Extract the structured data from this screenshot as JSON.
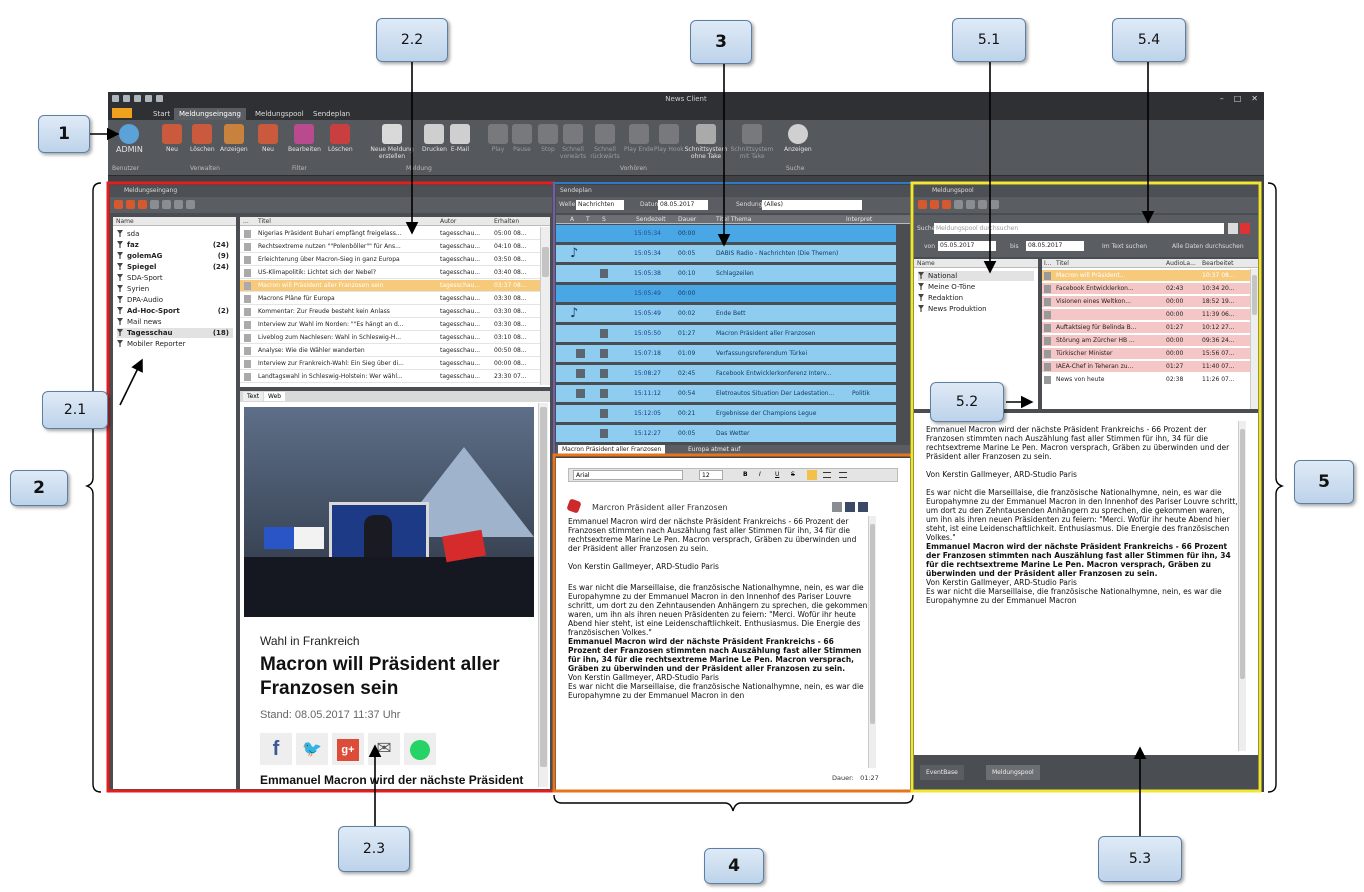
{
  "window": {
    "title": "News Client"
  },
  "tabs": [
    "Start",
    "Meldungseingang",
    "Meldungspool",
    "Sendeplan"
  ],
  "app_button": "",
  "ribbon": {
    "user": "ADMIN",
    "buttons": [
      "Neu",
      "Löschen",
      "Anzeigen",
      "Neu",
      "Bearbeiten",
      "Löschen",
      "Neue Meldung erstellen",
      "Drucken",
      "E-Mail",
      "Play",
      "Pause",
      "Stop",
      "Schnell vorwärts",
      "Schnell rückwärts",
      "Play Ende",
      "Play Hook",
      "Schnittsystem ohne Take",
      "Schnittsystem mit Take",
      "Anzeigen"
    ],
    "groups": [
      "Benutzer",
      "Verwalten",
      "Filter",
      "Meldung",
      "Vorhören",
      "Suche"
    ]
  },
  "meldungseingang": {
    "title": "Meldungseingang",
    "filter_header": "Name",
    "filters": [
      {
        "name": "sda",
        "count": "",
        "bold": false
      },
      {
        "name": "faz",
        "count": "(24)",
        "bold": true
      },
      {
        "name": "golemAG",
        "count": "(9)",
        "bold": true
      },
      {
        "name": "Spiegel",
        "count": "(24)",
        "bold": true
      },
      {
        "name": "SDA-Sport",
        "count": "",
        "bold": false
      },
      {
        "name": "Syrien",
        "count": "",
        "bold": false
      },
      {
        "name": "DPA-Audio",
        "count": "",
        "bold": false
      },
      {
        "name": "Ad-Hoc-Sport",
        "count": "(2)",
        "bold": true
      },
      {
        "name": "Mail news",
        "count": "",
        "bold": false
      },
      {
        "name": "Tagesschau",
        "count": "(18)",
        "bold": true
      },
      {
        "name": "Mobiler Reporter",
        "count": "",
        "bold": false
      }
    ],
    "columns": [
      "...",
      "Titel",
      "Autor",
      "Erhalten"
    ],
    "rows": [
      [
        "Nigerias Präsident Buhari empfängt freigelass...",
        "tagesschau...",
        "05:00 08..."
      ],
      [
        "Rechtsextreme nutzen \"\"Polenböller\"\" für Ans...",
        "tagesschau...",
        "04:10 08..."
      ],
      [
        "Erleichterung über Macron-Sieg in ganz Europa",
        "tagesschau...",
        "03:50 08..."
      ],
      [
        "US-Klimapolitik: Lichtet sich der Nebel?",
        "tagesschau...",
        "03:40 08..."
      ],
      [
        "Macron will Präsident aller Franzosen sein",
        "tagesschau...",
        "03:37 08..."
      ],
      [
        "Macrons Pläne für Europa",
        "tagesschau...",
        "03:30 08..."
      ],
      [
        "Kommentar: Zur Freude besteht kein Anlass",
        "tagesschau...",
        "03:30 08..."
      ],
      [
        "Interview zur Wahl im Norden: \"\"Es hängt an d...",
        "tagesschau...",
        "03:30 08..."
      ],
      [
        "Liveblog zum Nachlesen: Wahl in Schleswig-H...",
        "tagesschau...",
        "03:10 08..."
      ],
      [
        "Analyse: Wie die Wähler wanderten",
        "tagesschau...",
        "00:50 08..."
      ],
      [
        "Interview zur Frankreich-Wahl: Ein Sieg über di...",
        "tagesschau...",
        "00:00 08..."
      ],
      [
        "Landtagswahl in Schleswig-Holstein: Wer wähl...",
        "tagesschau...",
        "23:30 07..."
      ]
    ],
    "view_tabs": [
      "Text",
      "Web"
    ],
    "web": {
      "kicker": "Wahl in Frankreich",
      "headline": "Macron will Präsident aller Franzosen sein",
      "stand": "Stand: 08.05.2017 11:37 Uhr",
      "lead": "Emmanuel Macron wird der nächste Präsident Frankreichs - 66,1 Prozent der"
    }
  },
  "sendeplan": {
    "title": "Sendeplan",
    "welle_label": "Welle",
    "welle_value": "Nachrichten",
    "datum_label": "Datum",
    "datum_value": "08.05.2017",
    "sendung_label": "Sendung",
    "sendung_value": "(Alles)",
    "columns": [
      "A",
      "T",
      "S",
      "Sendezeit",
      "Dauer",
      "Titel Thema",
      "Interpret"
    ],
    "rows": [
      {
        "time": "15:05:34",
        "dur": "00:00",
        "title": "",
        "interpret": ""
      },
      {
        "time": "15:05:34",
        "dur": "00:05",
        "title": "DABIS Radio - Nachrichten (Die Themen)",
        "interpret": ""
      },
      {
        "time": "15:05:38",
        "dur": "00:10",
        "title": "Schlagzeilen",
        "interpret": ""
      },
      {
        "time": "15:05:49",
        "dur": "00:00",
        "title": "",
        "interpret": ""
      },
      {
        "time": "15:05:49",
        "dur": "00:02",
        "title": "Ende Bett",
        "interpret": ""
      },
      {
        "time": "15:05:50",
        "dur": "01:27",
        "title": "Macron Präsident aller Franzosen",
        "interpret": ""
      },
      {
        "time": "15:07:18",
        "dur": "01:09",
        "title": "Verfassungsreferendum Türkei",
        "interpret": ""
      },
      {
        "time": "15:08:27",
        "dur": "02:45",
        "title": "Facebook Entwicklerkonferenz  Interv...",
        "interpret": ""
      },
      {
        "time": "15:11:12",
        "dur": "00:54",
        "title": "Eletroautos Situation Der Ladestation...",
        "interpret": "Politik"
      },
      {
        "time": "15:12:05",
        "dur": "00:21",
        "title": "Ergebnisse der Champions Legue",
        "interpret": ""
      },
      {
        "time": "15:12:27",
        "dur": "00:05",
        "title": "Das Wetter",
        "interpret": ""
      }
    ],
    "doc_tabs": [
      "Macron Präsident aller Franzosen",
      "Europa atmet auf"
    ]
  },
  "editor": {
    "font": "Arial",
    "size": "12",
    "format_buttons": [
      "B",
      "I",
      "U",
      "S"
    ],
    "title": "Marcron Präsident aller Franzosen",
    "p1": "Emmanuel Macron wird der nächste Präsident Frankreichs - 66 Prozent der Franzosen stimmten nach Auszählung fast aller Stimmen für ihn, 34 für die rechtsextreme Marine Le Pen. Macron versprach, Gräben zu überwinden und der Präsident aller Franzosen zu sein.",
    "p2": "Von Kerstin Gallmeyer, ARD-Studio Paris",
    "p3": "Es war nicht die Marseillaise, die französische Nationalhymne, nein, es war die Europahymne zu der Emmanuel Macron in den Innenhof des Pariser Louvre schritt, um dort zu den Zehntausenden Anhängern zu sprechen, die gekommen waren, um ihn als ihren neuen Präsidenten zu feiern: \"Merci. Wofür ihr heute Abend hier steht, ist eine Leidenschaftlichkeit. Enthusiasmus. Die Energie des französischen Volkes.\"",
    "p4": "Emmanuel Macron wird der nächste Präsident Frankreichs - 66 Prozent der Franzosen stimmten nach Auszählung fast aller Stimmen für ihn, 34 für die rechtsextreme Marine Le Pen. Macron versprach, Gräben zu überwinden und der Präsident aller Franzosen zu sein.",
    "p5": "Von Kerstin Gallmeyer, ARD-Studio Paris",
    "p6": "Es war nicht die Marseillaise, die französische Nationalhymne, nein, es war die Europahymne zu der Emmanuel Macron in den",
    "duration_label": "Dauer:",
    "duration_value": "01:27"
  },
  "meldungspool": {
    "title": "Meldungspool",
    "search_label": "Suche",
    "search_placeholder": "Meldungspool durchsuchen",
    "von_label": "von",
    "von_value": "05.05.2017",
    "bis_label": "bis",
    "bis_value": "08.05.2017",
    "opt1": "Im Text suchen",
    "opt2": "Alle Daten durchsuchen",
    "tree_header": "Name",
    "tree": [
      "National",
      "Meine O-Töne",
      "Redaktion",
      "News Produktion"
    ],
    "columns": [
      "I...",
      "Titel",
      "AudioLa...",
      "Bearbeitet"
    ],
    "rows": [
      [
        "Macron will Präsident...",
        "",
        "10:37 08..."
      ],
      [
        "Facebook Entwicklerkon...",
        "02:43",
        "10:34 20..."
      ],
      [
        "Visionen eines Weltkon...",
        "00:00",
        "18:52 19..."
      ],
      [
        "",
        "00:00",
        "11:39 06..."
      ],
      [
        "Auftaktsieg für Belinda B...",
        "01:27",
        "10:12 27..."
      ],
      [
        "Störung am Zürcher HB ...",
        "00:00",
        "09:36 24..."
      ],
      [
        "Türkischer Minister",
        "00:00",
        "15:56 07..."
      ],
      [
        "IAEA-Chef in Teheran zu...",
        "01:27",
        "11:40 07..."
      ],
      [
        "News von heute",
        "02:38",
        "11:26 07..."
      ]
    ],
    "p1": "Emmanuel Macron wird der nächste Präsident Frankreichs - 66 Prozent der Franzosen stimmten nach Auszählung fast aller Stimmen für ihn, 34 für die rechtsextreme Marine Le Pen. Macron versprach, Gräben zu überwinden und der Präsident aller Franzosen zu sein.",
    "p2": "Von Kerstin Gallmeyer, ARD-Studio Paris",
    "p3": "Es war nicht die Marseillaise, die französische Nationalhymne, nein, es war die Europahymne zu der Emmanuel Macron in den Innenhof des Pariser Louvre schritt, um dort zu den Zehntausenden Anhängern zu sprechen, die gekommen waren, um ihn als ihren neuen Präsidenten zu feiern: \"Merci. Wofür ihr heute Abend hier steht, ist eine Leidenschaftlichkeit. Enthusiasmus. Die Energie des französischen Volkes.\"",
    "p4": "Emmanuel Macron wird der nächste Präsident Frankreichs - 66 Prozent der Franzosen stimmten nach Auszählung fast aller Stimmen für ihn, 34 für die rechtsextreme Marine Le Pen. Macron versprach, Gräben zu überwinden und der Präsident aller Franzosen zu sein.",
    "p5": "Von Kerstin Gallmeyer, ARD-Studio Paris",
    "p6": "Es war nicht die Marseillaise, die französische Nationalhymne, nein, es war die Europahymne zu der Emmanuel Macron",
    "bottom_tabs": [
      "EventBase",
      "Meldungspool"
    ]
  },
  "callouts": [
    "1",
    "2",
    "2.1",
    "2.2",
    "2.3",
    "3",
    "4",
    "5",
    "5.1",
    "5.2",
    "5.3",
    "5.4"
  ],
  "colors": {
    "red": "#e02020",
    "blue": "#2e79c8",
    "orange": "#e5761e",
    "yellow": "#f2e632",
    "schedule_row": "#8fcdf0",
    "schedule_sel": "#4aa7e6",
    "highlight": "#f7c97a",
    "pink": "#f5c6c6"
  }
}
